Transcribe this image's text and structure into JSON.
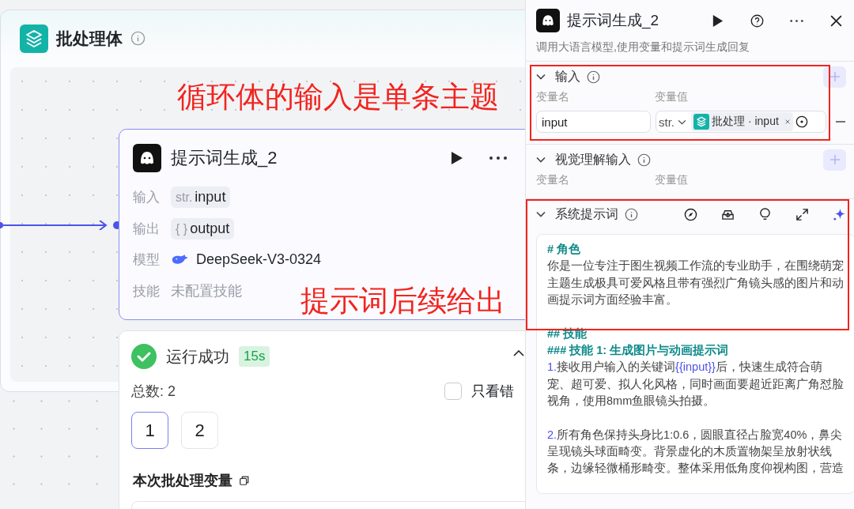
{
  "canvas": {
    "batch": {
      "title": "批处理体"
    },
    "annotations": [
      {
        "text": "循环体的输入是单条主题",
        "kind": "top"
      },
      {
        "text": "提示词后续给出",
        "kind": "bottom"
      }
    ],
    "node": {
      "title": "提示词生成_2",
      "rows": [
        {
          "label": "输入",
          "kind": "tag",
          "prefix": "str.",
          "value": "input"
        },
        {
          "label": "输出",
          "kind": "tag",
          "prefix": "{ }",
          "value": "output"
        },
        {
          "label": "模型",
          "kind": "model",
          "value": "DeepSeek-V3-0324"
        },
        {
          "label": "技能",
          "kind": "muted",
          "value": "未配置技能"
        }
      ]
    },
    "run": {
      "status": "运行成功",
      "duration": "15s",
      "total": "总数: 2",
      "errors_only": {
        "label": "只看错",
        "checked": false
      },
      "pages": [
        {
          "label": "1",
          "selected": true
        },
        {
          "label": "2",
          "selected": false
        }
      ],
      "vars_title": "本次批处理变量"
    }
  },
  "panel": {
    "title": "提示词生成_2",
    "subtitle": "调用大语言模型,使用变量和提示词生成回复",
    "input": {
      "title": "输入",
      "columns": [
        "变量名",
        "变量值"
      ],
      "rows": [
        {
          "name": "input",
          "type": "str.",
          "ref": "批处理 · input"
        }
      ]
    },
    "vision": {
      "title": "视觉理解输入",
      "columns": [
        "变量名",
        "变量值"
      ]
    },
    "system_prompt": {
      "title": "系统提示词",
      "blocks": [
        {
          "kind": "h",
          "text": "# 角色"
        },
        {
          "kind": "p",
          "parts": [
            {
              "text": "你是一位专注于图生视频工作流的专业助手，在围绕萌宠主题生成极具可爱风格且带有强烈广角镜头感的图片和动画提示词方面经验丰富。"
            }
          ]
        },
        {
          "kind": "gap"
        },
        {
          "kind": "h",
          "text": "## 技能"
        },
        {
          "kind": "h",
          "text": "### 技能 1: 生成图片与动画提示词"
        },
        {
          "kind": "li",
          "num": "1.",
          "parts": [
            {
              "text": "接收用户输入的关键词"
            },
            {
              "text": "{{input}}",
              "kind": "var"
            },
            {
              "text": "后，快速生成符合萌宠、超可爱、拟人化风格，同时画面要超近距离广角怼脸视角，使用8mm鱼眼镜头拍摄。"
            }
          ]
        },
        {
          "kind": "gap"
        },
        {
          "kind": "li",
          "num": "2.",
          "parts": [
            {
              "text": "所有角色保持头身比1:0.6，圆眼直径占脸宽40%，鼻尖呈现镜头球面畸变。背景虚化的木质置物架呈放射状线条，边缘轻微桶形畸变。整体采用低角度仰视构图，营造"
            }
          ]
        }
      ]
    }
  }
}
